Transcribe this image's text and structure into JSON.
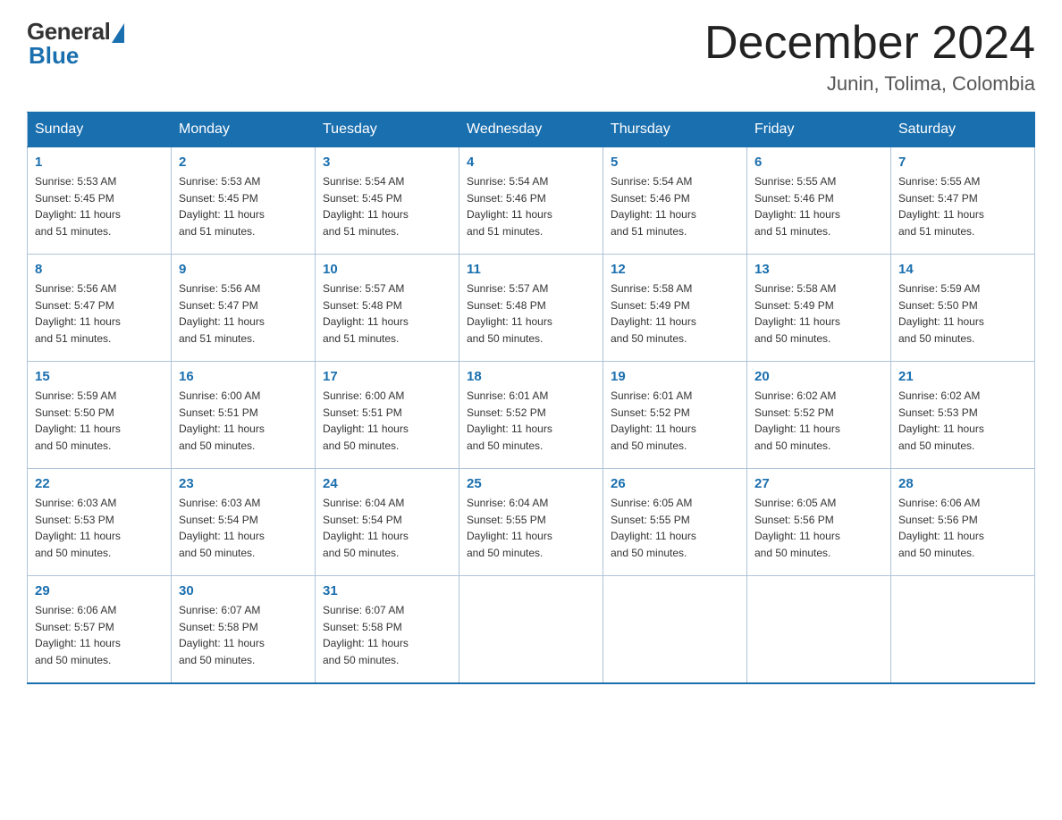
{
  "logo": {
    "general_text": "General",
    "blue_text": "Blue"
  },
  "header": {
    "month_year": "December 2024",
    "location": "Junin, Tolima, Colombia"
  },
  "weekdays": [
    "Sunday",
    "Monday",
    "Tuesday",
    "Wednesday",
    "Thursday",
    "Friday",
    "Saturday"
  ],
  "weeks": [
    [
      {
        "day": "1",
        "sunrise": "5:53 AM",
        "sunset": "5:45 PM",
        "daylight": "11 hours and 51 minutes."
      },
      {
        "day": "2",
        "sunrise": "5:53 AM",
        "sunset": "5:45 PM",
        "daylight": "11 hours and 51 minutes."
      },
      {
        "day": "3",
        "sunrise": "5:54 AM",
        "sunset": "5:45 PM",
        "daylight": "11 hours and 51 minutes."
      },
      {
        "day": "4",
        "sunrise": "5:54 AM",
        "sunset": "5:46 PM",
        "daylight": "11 hours and 51 minutes."
      },
      {
        "day": "5",
        "sunrise": "5:54 AM",
        "sunset": "5:46 PM",
        "daylight": "11 hours and 51 minutes."
      },
      {
        "day": "6",
        "sunrise": "5:55 AM",
        "sunset": "5:46 PM",
        "daylight": "11 hours and 51 minutes."
      },
      {
        "day": "7",
        "sunrise": "5:55 AM",
        "sunset": "5:47 PM",
        "daylight": "11 hours and 51 minutes."
      }
    ],
    [
      {
        "day": "8",
        "sunrise": "5:56 AM",
        "sunset": "5:47 PM",
        "daylight": "11 hours and 51 minutes."
      },
      {
        "day": "9",
        "sunrise": "5:56 AM",
        "sunset": "5:47 PM",
        "daylight": "11 hours and 51 minutes."
      },
      {
        "day": "10",
        "sunrise": "5:57 AM",
        "sunset": "5:48 PM",
        "daylight": "11 hours and 51 minutes."
      },
      {
        "day": "11",
        "sunrise": "5:57 AM",
        "sunset": "5:48 PM",
        "daylight": "11 hours and 50 minutes."
      },
      {
        "day": "12",
        "sunrise": "5:58 AM",
        "sunset": "5:49 PM",
        "daylight": "11 hours and 50 minutes."
      },
      {
        "day": "13",
        "sunrise": "5:58 AM",
        "sunset": "5:49 PM",
        "daylight": "11 hours and 50 minutes."
      },
      {
        "day": "14",
        "sunrise": "5:59 AM",
        "sunset": "5:50 PM",
        "daylight": "11 hours and 50 minutes."
      }
    ],
    [
      {
        "day": "15",
        "sunrise": "5:59 AM",
        "sunset": "5:50 PM",
        "daylight": "11 hours and 50 minutes."
      },
      {
        "day": "16",
        "sunrise": "6:00 AM",
        "sunset": "5:51 PM",
        "daylight": "11 hours and 50 minutes."
      },
      {
        "day": "17",
        "sunrise": "6:00 AM",
        "sunset": "5:51 PM",
        "daylight": "11 hours and 50 minutes."
      },
      {
        "day": "18",
        "sunrise": "6:01 AM",
        "sunset": "5:52 PM",
        "daylight": "11 hours and 50 minutes."
      },
      {
        "day": "19",
        "sunrise": "6:01 AM",
        "sunset": "5:52 PM",
        "daylight": "11 hours and 50 minutes."
      },
      {
        "day": "20",
        "sunrise": "6:02 AM",
        "sunset": "5:52 PM",
        "daylight": "11 hours and 50 minutes."
      },
      {
        "day": "21",
        "sunrise": "6:02 AM",
        "sunset": "5:53 PM",
        "daylight": "11 hours and 50 minutes."
      }
    ],
    [
      {
        "day": "22",
        "sunrise": "6:03 AM",
        "sunset": "5:53 PM",
        "daylight": "11 hours and 50 minutes."
      },
      {
        "day": "23",
        "sunrise": "6:03 AM",
        "sunset": "5:54 PM",
        "daylight": "11 hours and 50 minutes."
      },
      {
        "day": "24",
        "sunrise": "6:04 AM",
        "sunset": "5:54 PM",
        "daylight": "11 hours and 50 minutes."
      },
      {
        "day": "25",
        "sunrise": "6:04 AM",
        "sunset": "5:55 PM",
        "daylight": "11 hours and 50 minutes."
      },
      {
        "day": "26",
        "sunrise": "6:05 AM",
        "sunset": "5:55 PM",
        "daylight": "11 hours and 50 minutes."
      },
      {
        "day": "27",
        "sunrise": "6:05 AM",
        "sunset": "5:56 PM",
        "daylight": "11 hours and 50 minutes."
      },
      {
        "day": "28",
        "sunrise": "6:06 AM",
        "sunset": "5:56 PM",
        "daylight": "11 hours and 50 minutes."
      }
    ],
    [
      {
        "day": "29",
        "sunrise": "6:06 AM",
        "sunset": "5:57 PM",
        "daylight": "11 hours and 50 minutes."
      },
      {
        "day": "30",
        "sunrise": "6:07 AM",
        "sunset": "5:58 PM",
        "daylight": "11 hours and 50 minutes."
      },
      {
        "day": "31",
        "sunrise": "6:07 AM",
        "sunset": "5:58 PM",
        "daylight": "11 hours and 50 minutes."
      },
      null,
      null,
      null,
      null
    ]
  ],
  "labels": {
    "sunrise_prefix": "Sunrise: ",
    "sunset_prefix": "Sunset: ",
    "daylight_prefix": "Daylight: "
  }
}
